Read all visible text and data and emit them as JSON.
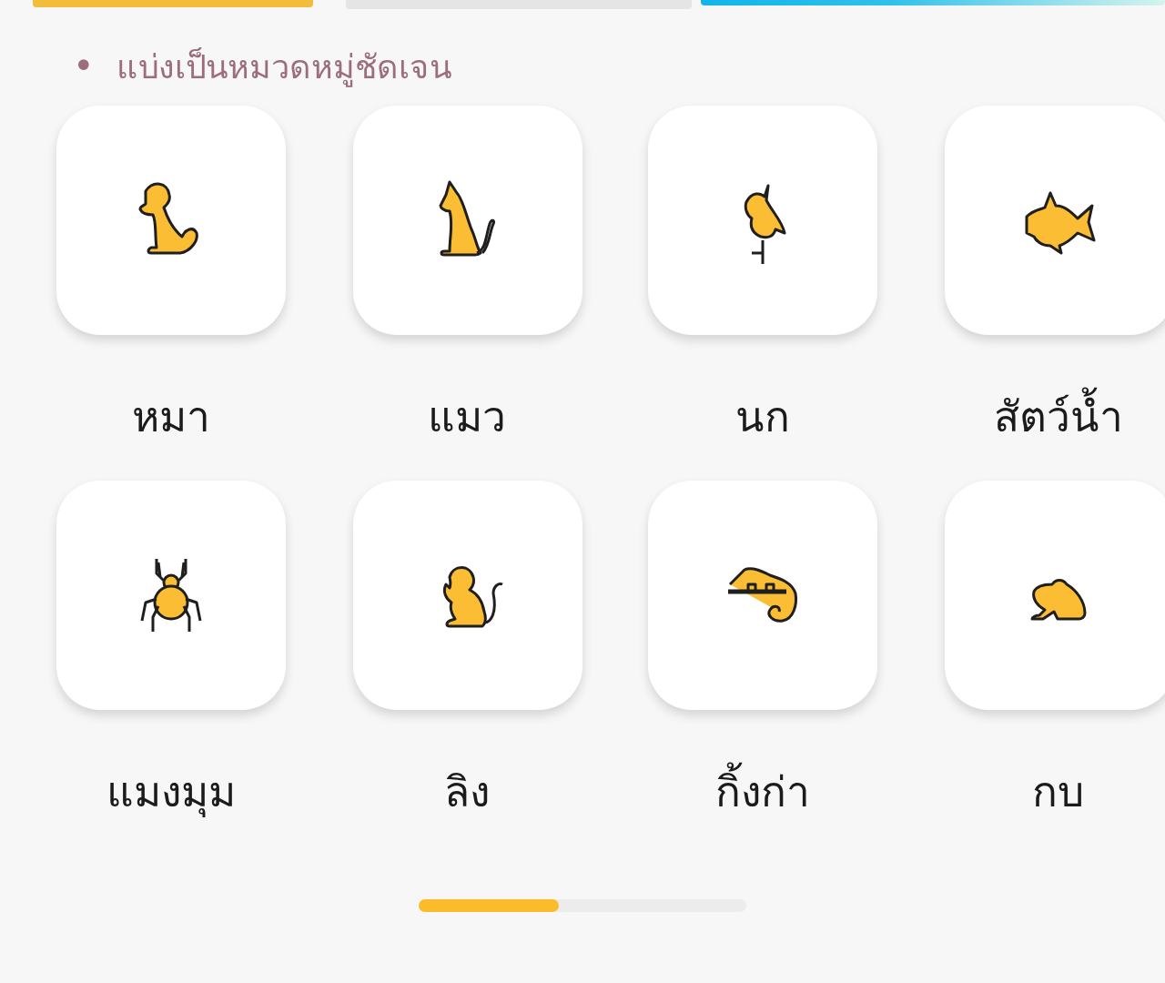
{
  "section": {
    "bullet": "•",
    "title": "แบ่งเป็นหมวดหมู่ชัดเจน"
  },
  "categories": [
    {
      "label": "หมา"
    },
    {
      "label": "แมว"
    },
    {
      "label": "นก"
    },
    {
      "label": "สัตว์น้ำ"
    },
    {
      "label": "แมงมุม"
    },
    {
      "label": "ลิง"
    },
    {
      "label": "กิ้งก่า"
    },
    {
      "label": "กบ"
    }
  ]
}
